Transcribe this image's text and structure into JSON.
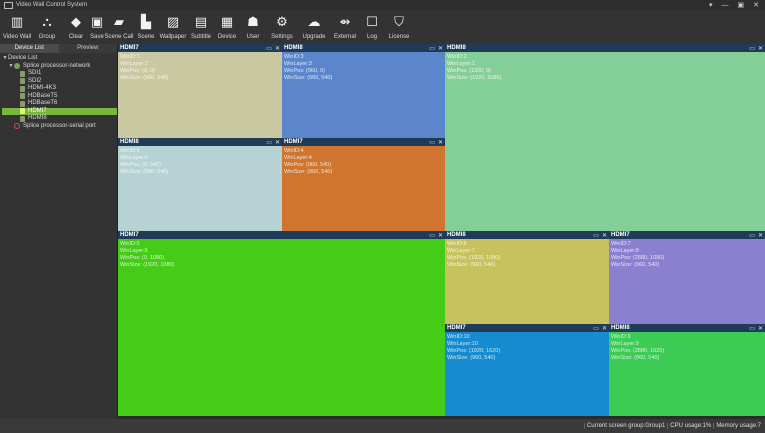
{
  "app": {
    "title": "Video Wall Control System"
  },
  "window_controls": [
    "▾",
    "—",
    "▣",
    "✕"
  ],
  "toolbar": [
    {
      "id": "video-wall",
      "label": "Video Wall",
      "icon": "video-wall-icon",
      "glyph": "▥"
    },
    {
      "id": "group",
      "label": "Group",
      "icon": "group-icon",
      "glyph": "⛬"
    },
    {
      "id": "clear",
      "label": "Clear",
      "icon": "clear-icon",
      "glyph": "◆"
    },
    {
      "id": "save",
      "label": "Save",
      "icon": "save-icon",
      "glyph": "▣"
    },
    {
      "id": "scene-call",
      "label": "Scene Call",
      "icon": "folder-open-icon",
      "glyph": "▰"
    },
    {
      "id": "scene",
      "label": "Scene",
      "icon": "scene-icon",
      "glyph": "▙"
    },
    {
      "id": "wallpaper",
      "label": "Wallpaper",
      "icon": "wallpaper-icon",
      "glyph": "▨"
    },
    {
      "id": "subtitle",
      "label": "Subtitle",
      "icon": "subtitle-icon",
      "glyph": "▤"
    },
    {
      "id": "device",
      "label": "Device",
      "icon": "device-icon",
      "glyph": "▦"
    },
    {
      "id": "user",
      "label": "User",
      "icon": "user-icon",
      "glyph": "☗"
    },
    {
      "id": "settings",
      "label": "Settings",
      "icon": "settings-icon",
      "glyph": "⚙"
    },
    {
      "id": "upgrade",
      "label": "Upgrade",
      "icon": "upgrade-icon",
      "glyph": "☁"
    },
    {
      "id": "external",
      "label": "External",
      "icon": "external-icon",
      "glyph": "⇴"
    },
    {
      "id": "log",
      "label": "Log",
      "icon": "log-icon",
      "glyph": "☐"
    },
    {
      "id": "license",
      "label": "License",
      "icon": "license-icon",
      "glyph": "⛉"
    }
  ],
  "sidebar": {
    "tabs": [
      {
        "label": "Device List",
        "active": true
      },
      {
        "label": "Preview",
        "active": false
      }
    ],
    "tree": [
      {
        "label": "Device List",
        "level": 0,
        "icon": "none",
        "twisty": "▼"
      },
      {
        "label": "Splice processor-network",
        "level": 1,
        "icon": "network",
        "twisty": "▼"
      },
      {
        "label": "SDI1",
        "level": 2,
        "icon": "device"
      },
      {
        "label": "SDI2",
        "level": 2,
        "icon": "device"
      },
      {
        "label": "HDMI-4K3",
        "level": 2,
        "icon": "device"
      },
      {
        "label": "HDBaseT5",
        "level": 2,
        "icon": "device"
      },
      {
        "label": "HDBaseT6",
        "level": 2,
        "icon": "device"
      },
      {
        "label": "HDMI7",
        "level": 2,
        "icon": "device",
        "selected": true
      },
      {
        "label": "HDMI8",
        "level": 2,
        "icon": "device"
      },
      {
        "label": "Splice processor-serial port",
        "level": 1,
        "icon": "serial"
      }
    ]
  },
  "windows": [
    {
      "name": "HDMI7",
      "lines": [
        "WinID:1",
        "WinLayer:2",
        "WinPos: (0, 0)",
        "WinSize: (960, 540)"
      ],
      "color": "#c9c8a0"
    },
    {
      "name": "HDMI8",
      "lines": [
        "WinID:3",
        "WinLayer:3",
        "WinPos: (960, 0)",
        "WinSize: (960, 540)"
      ],
      "color": "#5b86cc"
    },
    {
      "name": "HDMI8",
      "lines": [
        "WinID:2",
        "WinLayer:1",
        "WinPos: (1920, 0)",
        "WinSize: (1920, 1080)"
      ],
      "color": "#84cf98"
    },
    {
      "name": "HDMI8",
      "lines": [
        "WinID:6",
        "WinLayer:6",
        "WinPos: (0, 540)",
        "WinSize: (960, 540)"
      ],
      "color": "#b6d2d2"
    },
    {
      "name": "HDMI7",
      "lines": [
        "WinID:4",
        "WinLayer:4",
        "WinPos: (960, 540)",
        "WinSize: (960, 540)"
      ],
      "color": "#cf7530"
    },
    {
      "name": "HDMI7",
      "lines": [
        "WinID:5",
        "WinLayer:5",
        "WinPos: (0, 1080)",
        "WinSize: (1920, 1080)"
      ],
      "color": "#45cc16"
    },
    {
      "name": "HDMI8",
      "lines": [
        "WinID:8",
        "WinLayer:7",
        "WinPos: (1920, 1080)",
        "WinSize: (960, 540)"
      ],
      "color": "#c7c25e"
    },
    {
      "name": "HDMI7",
      "lines": [
        "WinID:7",
        "WinLayer:8",
        "WinPos: (2880, 1080)",
        "WinSize: (960, 540)"
      ],
      "color": "#8b7fd0"
    },
    {
      "name": "HDMI7",
      "lines": [
        "WinID:10",
        "WinLayer:10",
        "WinPos: (1920, 1620)",
        "WinSize: (960, 540)"
      ],
      "color": "#168bcf"
    },
    {
      "name": "HDMI8",
      "lines": [
        "WinID:9",
        "WinLayer:9",
        "WinPos: (2880, 1620)",
        "WinSize: (960, 540)"
      ],
      "color": "#3ccb55"
    }
  ],
  "statusbar": {
    "group": "Current screen group:Group1",
    "cpu": "CPU usage:1%",
    "memory": "Memory usage:7"
  }
}
